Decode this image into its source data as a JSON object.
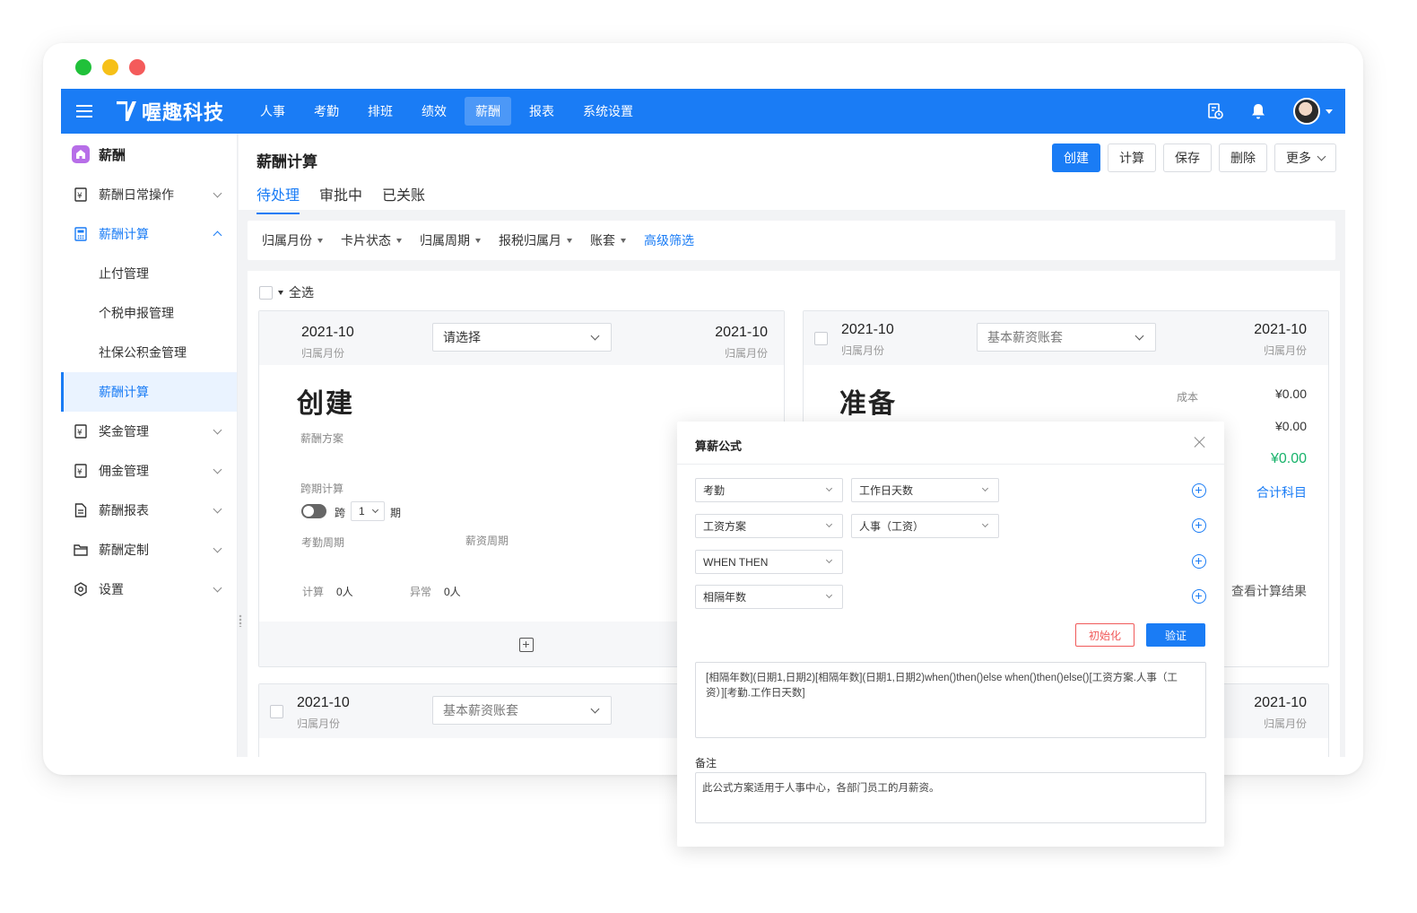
{
  "window": {
    "dots": [
      "#20c13a",
      "#f6c018",
      "#f45b5b"
    ]
  },
  "brand": {
    "name": "喔趣科技"
  },
  "nav": {
    "items": [
      {
        "label": "人事"
      },
      {
        "label": "考勤"
      },
      {
        "label": "排班"
      },
      {
        "label": "绩效"
      },
      {
        "label": "薪酬",
        "active": true
      },
      {
        "label": "报表"
      },
      {
        "label": "系统设置"
      }
    ]
  },
  "sidebar": {
    "title": "薪酬",
    "items": [
      {
        "label": "薪酬日常操作"
      },
      {
        "label": "薪酬计算"
      },
      {
        "label": "奖金管理"
      },
      {
        "label": "佣金管理"
      },
      {
        "label": "薪酬报表"
      },
      {
        "label": "薪酬定制"
      },
      {
        "label": "设置"
      }
    ],
    "subitems": [
      {
        "label": "止付管理"
      },
      {
        "label": "个税申报管理"
      },
      {
        "label": "社保公积金管理"
      },
      {
        "label": "薪酬计算"
      }
    ]
  },
  "page": {
    "title": "薪酬计算",
    "actions": {
      "create": "创建",
      "calc": "计算",
      "save": "保存",
      "delete": "删除",
      "more": "更多"
    },
    "tabs": [
      {
        "label": "待处理"
      },
      {
        "label": "审批中"
      },
      {
        "label": "已关账"
      }
    ],
    "filters": [
      {
        "label": "归属月份"
      },
      {
        "label": "卡片状态"
      },
      {
        "label": "归属周期"
      },
      {
        "label": "报税归属月"
      },
      {
        "label": "账套"
      }
    ],
    "advanced_filter": "高级筛选",
    "select_all": "全选"
  },
  "card1": {
    "month": "2021-10",
    "month_label": "归属月份",
    "select_placeholder": "请选择",
    "right_month": "2021-10",
    "right_month_label": "归属月份",
    "status": "创建",
    "scheme_label": "薪酬方案",
    "cross_label": "跨期计算",
    "cross_prefix": "跨",
    "cross_value": "1",
    "cross_suffix": "期",
    "att_period": "考勤周期",
    "pay_period": "薪资周期",
    "calc_label": "计算",
    "calc_value": "0人",
    "abn_label": "异常",
    "abn_value": "0人"
  },
  "card2": {
    "month": "2021-10",
    "month_label": "归属月份",
    "account": "基本薪资账套",
    "right_month": "2021-10",
    "right_month_label": "归属月份",
    "status": "准备",
    "cost_label": "成本",
    "cost_value": "¥0.00",
    "value2": "¥0.00",
    "value3": "¥0.00",
    "total_link": "合计科目",
    "view_result": "查看计算结果"
  },
  "card3": {
    "month": "2021-10",
    "month_label": "归属月份",
    "account": "基本薪资账套",
    "right_month": "2021-10",
    "right_month_label": "归属月份"
  },
  "dialog": {
    "title": "算薪公式",
    "rows": [
      {
        "left": "考勤",
        "right": "工作日天数"
      },
      {
        "left": "工资方案",
        "right": "人事（工资）"
      },
      {
        "left": "WHEN THEN"
      },
      {
        "left": "相隔年数"
      }
    ],
    "reset": "初始化",
    "verify": "验证",
    "formula": "[相隔年数](日期1,日期2)[相隔年数](日期1,日期2)when()then()else when()then()else()[工资方案.人事（工资）][考勤.工作日天数]",
    "note_label": "备注",
    "note": "此公式方案适用于人事中心，各部门员工的月薪资。"
  },
  "colors": {
    "accent": "#1a7cf5",
    "green": "#19b36b",
    "danger": "#f05a5a"
  }
}
